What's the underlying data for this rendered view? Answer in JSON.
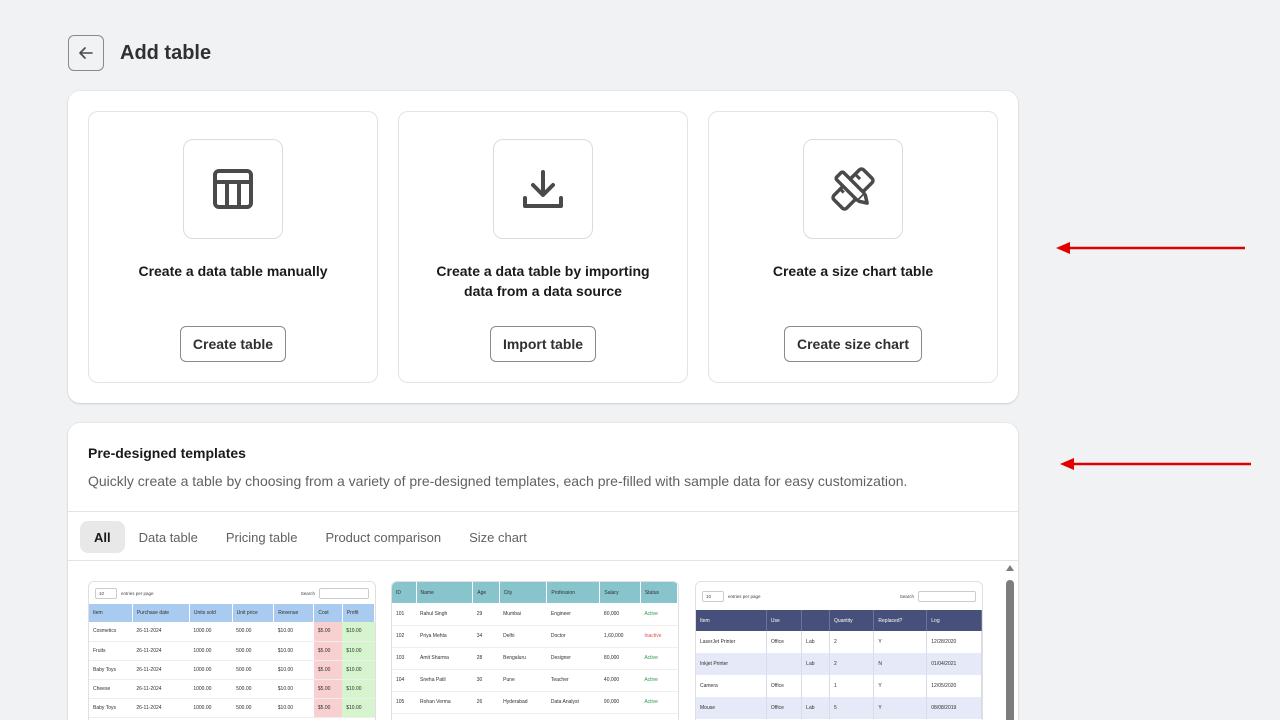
{
  "header": {
    "title": "Add table"
  },
  "options": [
    {
      "title": "Create a data table manually",
      "button": "Create table",
      "icon": "table-icon"
    },
    {
      "title": "Create a data table by importing data from a data source",
      "button": "Import table",
      "icon": "download-icon"
    },
    {
      "title": "Create a size chart table",
      "button": "Create size chart",
      "icon": "ruler-pencil-icon"
    }
  ],
  "templates": {
    "title": "Pre-designed templates",
    "description": "Quickly create a table by choosing from a variety of pre-designed templates, each pre-filled with sample data for easy customization.",
    "tabs": [
      "All",
      "Data table",
      "Pricing table",
      "Product comparison",
      "Size chart"
    ],
    "active_tab": "All"
  },
  "preview1": {
    "entries_value": "10",
    "entries_label": "entries per page",
    "search_label": "Search",
    "headers": [
      "Item",
      "Purchase date",
      "Units sold",
      "Unit price",
      "Revenue",
      "Cost",
      "Profit"
    ],
    "rows": [
      [
        "Cosmetics",
        "26-11-2024",
        "1000.00",
        "500.00",
        "$10.00",
        "$5.00",
        "$10.00"
      ],
      [
        "Fruits",
        "26-11-2024",
        "1000.00",
        "500.00",
        "$10.00",
        "$5.00",
        "$10.00"
      ],
      [
        "Baby Toys",
        "26-11-2024",
        "1000.00",
        "500.00",
        "$10.00",
        "$5.00",
        "$10.00"
      ],
      [
        "Cheese",
        "26-11-2024",
        "1000.00",
        "500.00",
        "$10.00",
        "$5.00",
        "$10.00"
      ],
      [
        "Baby Toys",
        "26-11-2024",
        "1000.00",
        "500.00",
        "$10.00",
        "$5.00",
        "$10.00"
      ]
    ]
  },
  "preview2": {
    "headers": [
      "ID",
      "Name",
      "Age",
      "City",
      "Profession",
      "Salary",
      "Status"
    ],
    "rows": [
      [
        "101",
        "Rahul Singh",
        "29",
        "Mumbai",
        "Engineer",
        "80,000",
        "Active"
      ],
      [
        "102",
        "Priya Mehta",
        "34",
        "Delhi",
        "Doctor",
        "1,60,000",
        "Inactive"
      ],
      [
        "103",
        "Amit Sharma",
        "28",
        "Bengaluru",
        "Designer",
        "80,000",
        "Active"
      ],
      [
        "104",
        "Sneha Patil",
        "30",
        "Pune",
        "Teacher",
        "40,000",
        "Active"
      ],
      [
        "105",
        "Rohan Verma",
        "26",
        "Hyderabad",
        "Data Analyst",
        "90,000",
        "Active"
      ]
    ]
  },
  "preview3": {
    "entries_value": "10",
    "entries_label": "entries per page",
    "search_label": "Search",
    "headers": [
      "Item",
      "Use",
      "",
      "Quantity",
      "Replaced?",
      "Log"
    ],
    "rows": [
      [
        "LaserJet Printer",
        "Office",
        "Lab",
        "2",
        "Y",
        "12/28/2020"
      ],
      [
        "Inkjet Printer",
        "",
        "Lab",
        "2",
        "N",
        "01/04/2021"
      ],
      [
        "Camera",
        "Office",
        "",
        "1",
        "Y",
        "12/05/2020"
      ],
      [
        "Mouse",
        "Office",
        "Lab",
        "5",
        "Y",
        "08/08/2019"
      ]
    ]
  },
  "colors": {
    "annotation_arrow": "#e00000",
    "preview1_header": "#a9cbf0",
    "preview2_header": "#88c4cc",
    "preview3_header": "#46507a"
  }
}
